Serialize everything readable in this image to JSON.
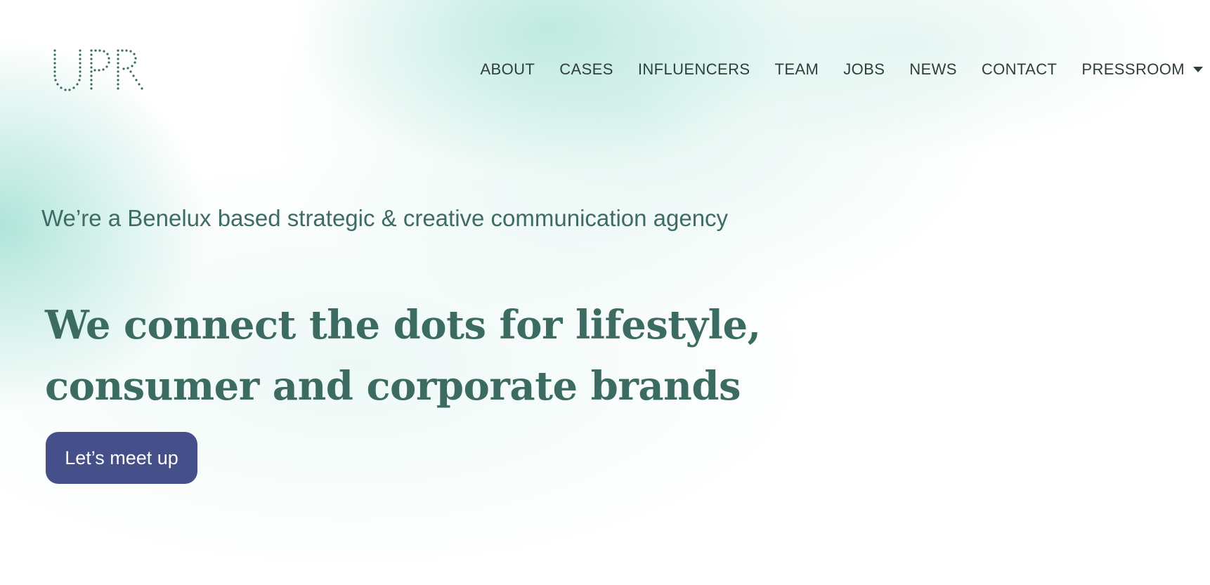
{
  "header": {
    "logo_text": "UPR",
    "nav": {
      "items": [
        {
          "label": "ABOUT"
        },
        {
          "label": "CASES"
        },
        {
          "label": "INFLUENCERS"
        },
        {
          "label": "TEAM"
        },
        {
          "label": "JOBS"
        },
        {
          "label": "NEWS"
        },
        {
          "label": "CONTACT"
        }
      ],
      "dropdown": {
        "label": "PRESSROOM",
        "icon": "caret-down-icon"
      }
    }
  },
  "hero": {
    "tagline": "We’re a Benelux based strategic & creative communication agency",
    "headline_lines": [
      "We connect the dots for lifestyle,",
      "consumer and corporate brands"
    ],
    "cta_label": "Let’s meet up"
  },
  "colors": {
    "accent": "#454f8a",
    "heading": "#3b6b61",
    "tagline": "#3e6b64",
    "nav_text": "#2f3e3a",
    "gradient_mint": "#96dccd"
  }
}
